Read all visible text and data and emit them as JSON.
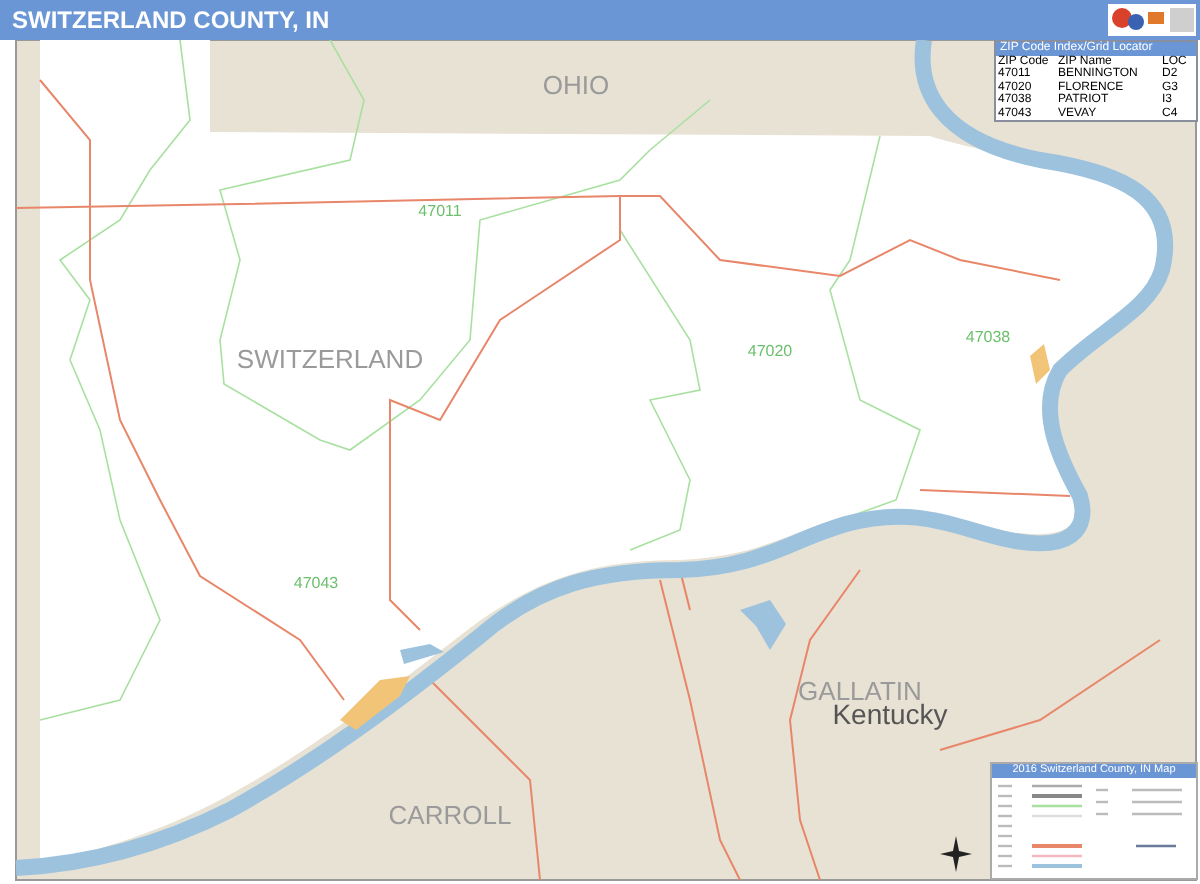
{
  "header": {
    "title": "SWITZERLAND COUNTY, IN"
  },
  "map": {
    "labels": [
      {
        "text": "OHIO",
        "kind": "county"
      },
      {
        "text": "47011",
        "kind": "zip"
      },
      {
        "text": "SWITZERLAND",
        "kind": "county"
      },
      {
        "text": "47020",
        "kind": "zip"
      },
      {
        "text": "47038",
        "kind": "zip"
      },
      {
        "text": "47043",
        "kind": "zip"
      },
      {
        "text": "GALLATIN",
        "kind": "county"
      },
      {
        "text": "Kentucky",
        "kind": "state"
      },
      {
        "text": "CARROLL",
        "kind": "county"
      }
    ]
  },
  "zip_index": {
    "title": "ZIP Code Index/Grid Locator",
    "columns": [
      "ZIP Code",
      "ZIP Name",
      "LOC"
    ],
    "rows": [
      [
        "47011",
        "BENNINGTON",
        "D2"
      ],
      [
        "47020",
        "FLORENCE",
        "G3"
      ],
      [
        "47038",
        "PATRIOT",
        "I3"
      ],
      [
        "47043",
        "VEVAY",
        "C4"
      ]
    ]
  },
  "legend": {
    "title": "2016 Switzerland County, IN Map"
  }
}
